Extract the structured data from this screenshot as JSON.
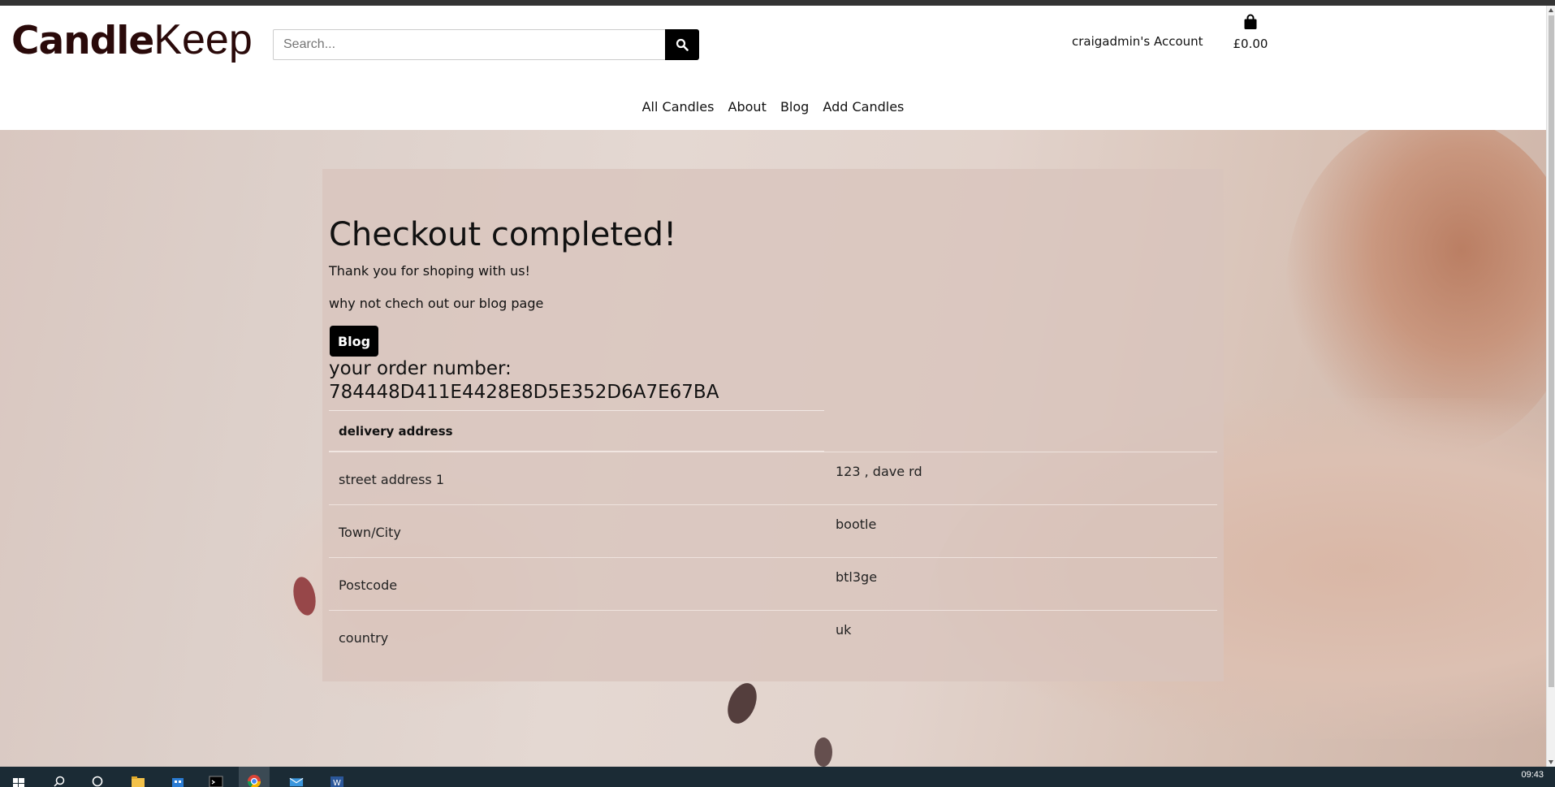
{
  "site": {
    "logo_bold": "Candle",
    "logo_light": "Keep"
  },
  "header": {
    "search_placeholder": "Search...",
    "account_label": "craigadmin's Account",
    "cart_total": "£0.00"
  },
  "nav": {
    "items": [
      "All Candles",
      "About",
      "Blog",
      "Add Candles"
    ]
  },
  "checkout": {
    "title": "Checkout completed!",
    "thank_you": "Thank you for shoping with us!",
    "blog_prompt": "why not chech out our blog page",
    "blog_button": "Blog",
    "order_label": "your order number:",
    "order_number": "784448D411E4428E8D5E352D6A7E67BA",
    "address_heading": "delivery address",
    "address_rows": [
      {
        "label": "street address 1",
        "value": "123 , dave rd"
      },
      {
        "label": "Town/City",
        "value": "bootle"
      },
      {
        "label": "Postcode",
        "value": "btl3ge"
      },
      {
        "label": "country",
        "value": "uk"
      }
    ]
  },
  "taskbar": {
    "clock": "09:43",
    "icons": [
      "windows-start-icon",
      "search-icon",
      "cortana-icon",
      "file-explorer-icon",
      "store-icon",
      "terminal-icon",
      "chrome-icon",
      "mail-icon",
      "word-icon"
    ]
  },
  "colors": {
    "accent": "#000000",
    "brand": "#2a0a0a",
    "panel": "#d9c4bc",
    "taskbar": "#1b2b35"
  }
}
